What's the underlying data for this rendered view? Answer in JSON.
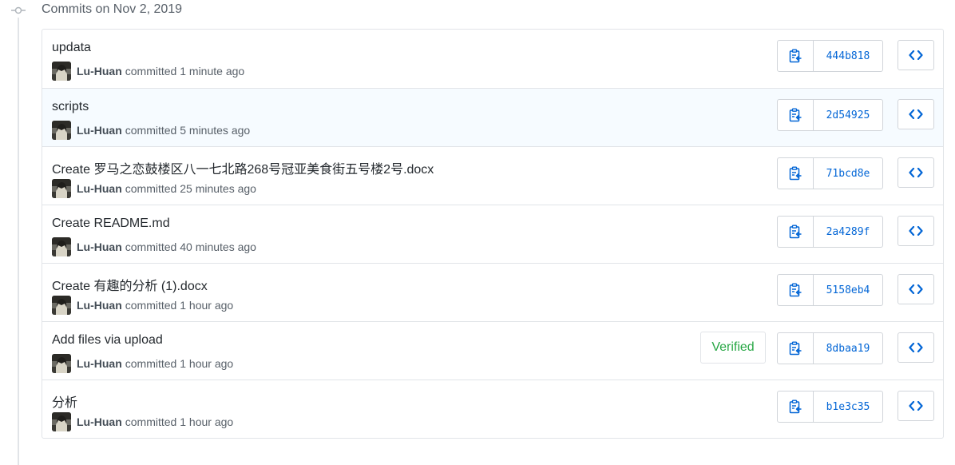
{
  "header": {
    "title": "Commits on Nov 2, 2019",
    "node_icon": "git-commit-icon"
  },
  "colors": {
    "link": "#0366d6",
    "verified": "#28a745",
    "border": "#e1e4e8",
    "highlight_row": "#f6fbff"
  },
  "icons": {
    "copy": "clipboard-icon",
    "browse": "code-brackets-icon",
    "avatar": "user-avatar"
  },
  "commits": [
    {
      "title": "updata",
      "author": "Lu-Huan",
      "committed_text": "committed 1 minute ago",
      "sha": "444b818",
      "verified": ""
    },
    {
      "title": "scripts",
      "author": "Lu-Huan",
      "committed_text": "committed 5 minutes ago",
      "sha": "2d54925",
      "verified": ""
    },
    {
      "title": "Create 罗马之恋鼓楼区八一七北路268号冠亚美食街五号楼2号.docx",
      "author": "Lu-Huan",
      "committed_text": "committed 25 minutes ago",
      "sha": "71bcd8e",
      "verified": ""
    },
    {
      "title": "Create README.md",
      "author": "Lu-Huan",
      "committed_text": "committed 40 minutes ago",
      "sha": "2a4289f",
      "verified": ""
    },
    {
      "title": "Create 有趣的分析 (1).docx",
      "author": "Lu-Huan",
      "committed_text": "committed 1 hour ago",
      "sha": "5158eb4",
      "verified": ""
    },
    {
      "title": "Add files via upload",
      "author": "Lu-Huan",
      "committed_text": "committed 1 hour ago",
      "sha": "8dbaa19",
      "verified": "Verified"
    },
    {
      "title": "分析",
      "author": "Lu-Huan",
      "committed_text": "committed 1 hour ago",
      "sha": "b1e3c35",
      "verified": ""
    }
  ]
}
